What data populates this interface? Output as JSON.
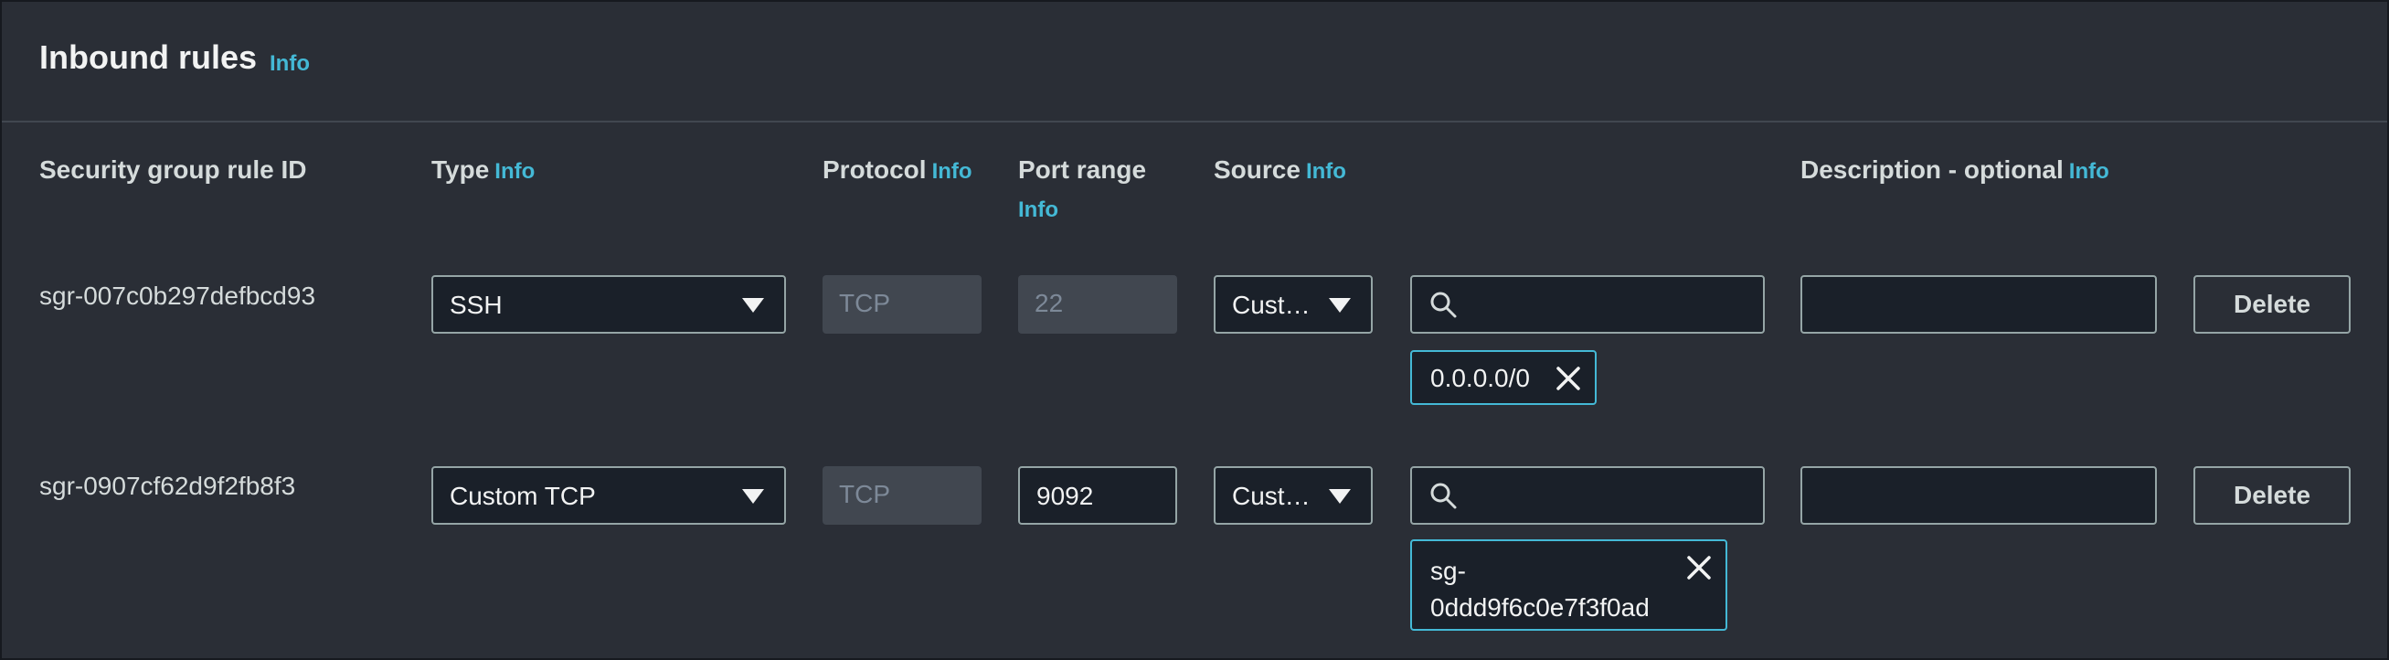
{
  "section": {
    "title": "Inbound rules",
    "info": "Info"
  },
  "columns": {
    "rule_id": "Security group rule ID",
    "type": "Type",
    "protocol": "Protocol",
    "port_range": "Port range",
    "source": "Source",
    "description": "Description - optional",
    "info": "Info"
  },
  "rules": [
    {
      "id": "sgr-007c0b297defbcd93",
      "type": "SSH",
      "protocol": "TCP",
      "port": "22",
      "port_editable": false,
      "source": "Cust…",
      "search_value": "",
      "token": "0.0.0.0/0",
      "description": "",
      "delete": "Delete"
    },
    {
      "id": "sgr-0907cf62d9f2fb8f3",
      "type": "Custom TCP",
      "protocol": "TCP",
      "port": "9092",
      "port_editable": true,
      "source": "Cust…",
      "search_value": "",
      "token_line1": "sg-",
      "token_line2": "0ddd9f6c0e7f3f0ad",
      "description": "",
      "delete": "Delete"
    }
  ],
  "colors": {
    "background": "#2a2e36",
    "field_bg": "#1a2029",
    "accent": "#44b9d6",
    "border": "#95a5a6"
  }
}
